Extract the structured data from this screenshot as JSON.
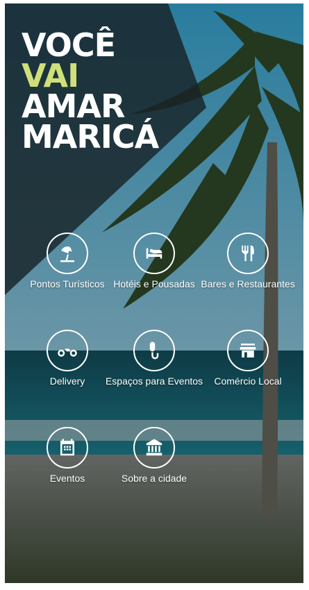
{
  "logo": {
    "line1": "VOCÊ",
    "line2": "VAI",
    "line3": "AMAR",
    "line4": "MARICÁ"
  },
  "menu": {
    "items": [
      {
        "label": "Pontos Turísticos",
        "icon": "beach-umbrella-icon"
      },
      {
        "label": "Hotéis e Pousadas",
        "icon": "hotel-bed-icon"
      },
      {
        "label": "Bares e Restaurantes",
        "icon": "restaurant-icon"
      },
      {
        "label": "Delivery",
        "icon": "motorcycle-icon"
      },
      {
        "label": "Espaços para Eventos",
        "icon": "microphone-icon"
      },
      {
        "label": "Comércio Local",
        "icon": "store-icon"
      },
      {
        "label": "Eventos",
        "icon": "calendar-icon"
      },
      {
        "label": "Sobre a cidade",
        "icon": "museum-icon"
      }
    ]
  },
  "colors": {
    "logo_accent": "#cfe07a",
    "sky": "#2fa8d8",
    "sea": "#0f6f7a",
    "overlay": "#1c2a2e"
  }
}
